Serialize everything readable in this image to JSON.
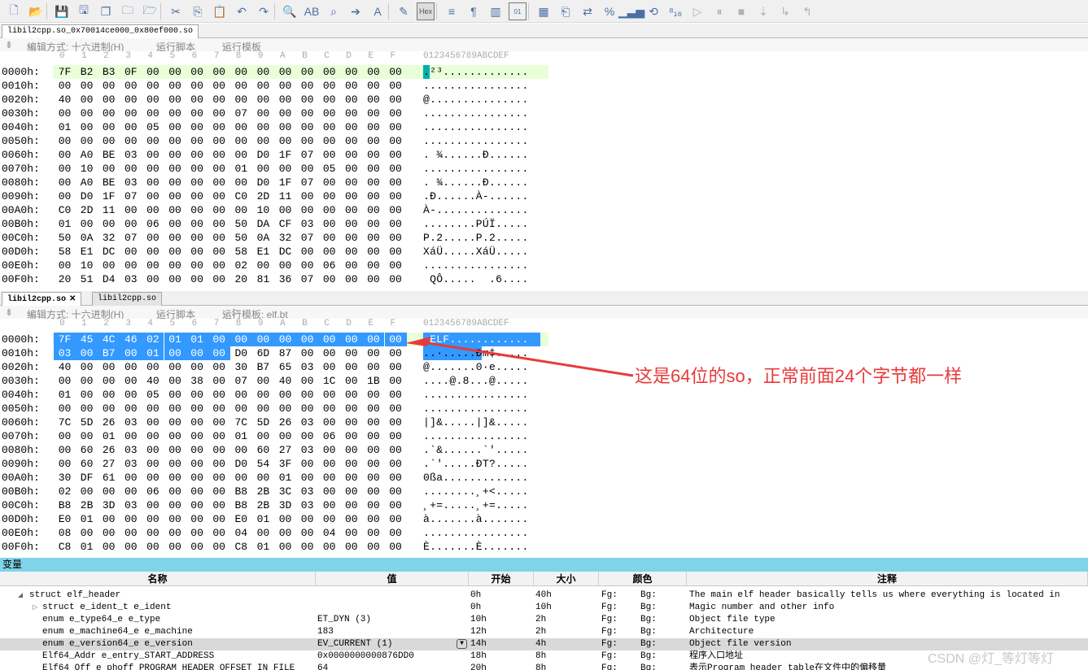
{
  "toolbar": {
    "icons": [
      "new-file-icon",
      "open-icon",
      "save-icon",
      "save-as-icon",
      "save-all-icon",
      "folder-icon",
      "workspace-icon",
      "cut-icon",
      "copy-icon",
      "paste-icon",
      "undo-icon",
      "redo-icon",
      "find-icon",
      "replace-icon",
      "find-in-files-icon",
      "goto-icon",
      "font-icon",
      "highlight-icon",
      "hex-mode-icon",
      "word-wrap-icon",
      "paragraph-icon",
      "columns-icon",
      "binary-icon",
      "calculator-icon",
      "template-icon",
      "compare-icon",
      "checksum-icon",
      "histogram-icon",
      "base-convert-icon",
      "base-icon",
      "run-icon",
      "pause-icon",
      "stop-icon",
      "step-icon",
      "step-in-icon",
      "step-out-icon"
    ],
    "hex_label": "Hex"
  },
  "top": {
    "tab_label": "libil2cpp.so_0x70014ce000_0x80ef000.so",
    "edit_mode": "编辑方式: 十六进制(H)",
    "run_script": "运行脚本",
    "run_template": "运行模板",
    "col_headers": [
      "0",
      "1",
      "2",
      "3",
      "4",
      "5",
      "6",
      "7",
      "8",
      "9",
      "A",
      "B",
      "C",
      "D",
      "E",
      "F"
    ],
    "ascii_header": "0123456789ABCDEF",
    "rows": [
      {
        "addr": "0000h:",
        "bytes": [
          "7F",
          "B2",
          "B3",
          "0F",
          "00",
          "00",
          "00",
          "00",
          "00",
          "00",
          "00",
          "00",
          "00",
          "00",
          "00",
          "00"
        ],
        "ascii": ".²³............."
      },
      {
        "addr": "0010h:",
        "bytes": [
          "00",
          "00",
          "00",
          "00",
          "00",
          "00",
          "00",
          "00",
          "00",
          "00",
          "00",
          "00",
          "00",
          "00",
          "00",
          "00"
        ],
        "ascii": "................"
      },
      {
        "addr": "0020h:",
        "bytes": [
          "40",
          "00",
          "00",
          "00",
          "00",
          "00",
          "00",
          "00",
          "00",
          "00",
          "00",
          "00",
          "00",
          "00",
          "00",
          "00"
        ],
        "ascii": "@..............."
      },
      {
        "addr": "0030h:",
        "bytes": [
          "00",
          "00",
          "00",
          "00",
          "00",
          "00",
          "00",
          "00",
          "07",
          "00",
          "00",
          "00",
          "00",
          "00",
          "00",
          "00"
        ],
        "ascii": "................"
      },
      {
        "addr": "0040h:",
        "bytes": [
          "01",
          "00",
          "00",
          "00",
          "05",
          "00",
          "00",
          "00",
          "00",
          "00",
          "00",
          "00",
          "00",
          "00",
          "00",
          "00"
        ],
        "ascii": "................"
      },
      {
        "addr": "0050h:",
        "bytes": [
          "00",
          "00",
          "00",
          "00",
          "00",
          "00",
          "00",
          "00",
          "00",
          "00",
          "00",
          "00",
          "00",
          "00",
          "00",
          "00"
        ],
        "ascii": "................"
      },
      {
        "addr": "0060h:",
        "bytes": [
          "00",
          "A0",
          "BE",
          "03",
          "00",
          "00",
          "00",
          "00",
          "00",
          "D0",
          "1F",
          "07",
          "00",
          "00",
          "00",
          "00"
        ],
        "ascii": ". ¾......Ð......"
      },
      {
        "addr": "0070h:",
        "bytes": [
          "00",
          "10",
          "00",
          "00",
          "00",
          "00",
          "00",
          "00",
          "01",
          "00",
          "00",
          "00",
          "05",
          "00",
          "00",
          "00"
        ],
        "ascii": "................"
      },
      {
        "addr": "0080h:",
        "bytes": [
          "00",
          "A0",
          "BE",
          "03",
          "00",
          "00",
          "00",
          "00",
          "00",
          "D0",
          "1F",
          "07",
          "00",
          "00",
          "00",
          "00"
        ],
        "ascii": ". ¾......Ð......"
      },
      {
        "addr": "0090h:",
        "bytes": [
          "00",
          "D0",
          "1F",
          "07",
          "00",
          "00",
          "00",
          "00",
          "C0",
          "2D",
          "11",
          "00",
          "00",
          "00",
          "00",
          "00"
        ],
        "ascii": ".Ð......À-......"
      },
      {
        "addr": "00A0h:",
        "bytes": [
          "C0",
          "2D",
          "11",
          "00",
          "00",
          "00",
          "00",
          "00",
          "00",
          "10",
          "00",
          "00",
          "00",
          "00",
          "00",
          "00"
        ],
        "ascii": "À-.............."
      },
      {
        "addr": "00B0h:",
        "bytes": [
          "01",
          "00",
          "00",
          "00",
          "06",
          "00",
          "00",
          "00",
          "50",
          "DA",
          "CF",
          "03",
          "00",
          "00",
          "00",
          "00"
        ],
        "ascii": "........PÚÏ....."
      },
      {
        "addr": "00C0h:",
        "bytes": [
          "50",
          "0A",
          "32",
          "07",
          "00",
          "00",
          "00",
          "00",
          "50",
          "0A",
          "32",
          "07",
          "00",
          "00",
          "00",
          "00"
        ],
        "ascii": "P.2.....P.2....."
      },
      {
        "addr": "00D0h:",
        "bytes": [
          "58",
          "E1",
          "DC",
          "00",
          "00",
          "00",
          "00",
          "00",
          "58",
          "E1",
          "DC",
          "00",
          "00",
          "00",
          "00",
          "00"
        ],
        "ascii": "XáÜ.....XáÜ....."
      },
      {
        "addr": "00E0h:",
        "bytes": [
          "00",
          "10",
          "00",
          "00",
          "00",
          "00",
          "00",
          "00",
          "02",
          "00",
          "00",
          "00",
          "06",
          "00",
          "00",
          "00"
        ],
        "ascii": "................"
      },
      {
        "addr": "00F0h:",
        "bytes": [
          "20",
          "51",
          "D4",
          "03",
          "00",
          "00",
          "00",
          "00",
          "20",
          "81",
          "36",
          "07",
          "00",
          "00",
          "00",
          "00"
        ],
        "ascii": " QÔ.....  .6...."
      }
    ]
  },
  "bottom": {
    "tab_active": "libil2cpp.so",
    "tab_other": "libil2cpp.so",
    "edit_mode": "编辑方式: 十六进制(H)",
    "run_script": "运行脚本",
    "run_template": "运行模板: elf.bt",
    "col_headers": [
      "0",
      "1",
      "2",
      "3",
      "4",
      "5",
      "6",
      "7",
      "8",
      "9",
      "A",
      "B",
      "C",
      "D",
      "E",
      "F"
    ],
    "ascii_header": "0123456789ABCDEF",
    "rows": [
      {
        "addr": "0000h:",
        "bytes": [
          "7F",
          "45",
          "4C",
          "46",
          "02",
          "01",
          "01",
          "00",
          "00",
          "00",
          "00",
          "00",
          "00",
          "00",
          "00",
          "00"
        ],
        "ascii": ".ELF............"
      },
      {
        "addr": "0010h:",
        "bytes": [
          "03",
          "00",
          "B7",
          "00",
          "01",
          "00",
          "00",
          "00",
          "D0",
          "6D",
          "87",
          "00",
          "00",
          "00",
          "00",
          "00"
        ],
        "ascii": "..·.....Ðm‡....."
      },
      {
        "addr": "0020h:",
        "bytes": [
          "40",
          "00",
          "00",
          "00",
          "00",
          "00",
          "00",
          "00",
          "30",
          "B7",
          "65",
          "03",
          "00",
          "00",
          "00",
          "00"
        ],
        "ascii": "@.......0·e....."
      },
      {
        "addr": "0030h:",
        "bytes": [
          "00",
          "00",
          "00",
          "00",
          "40",
          "00",
          "38",
          "00",
          "07",
          "00",
          "40",
          "00",
          "1C",
          "00",
          "1B",
          "00"
        ],
        "ascii": "....@.8...@....."
      },
      {
        "addr": "0040h:",
        "bytes": [
          "01",
          "00",
          "00",
          "00",
          "05",
          "00",
          "00",
          "00",
          "00",
          "00",
          "00",
          "00",
          "00",
          "00",
          "00",
          "00"
        ],
        "ascii": "................"
      },
      {
        "addr": "0050h:",
        "bytes": [
          "00",
          "00",
          "00",
          "00",
          "00",
          "00",
          "00",
          "00",
          "00",
          "00",
          "00",
          "00",
          "00",
          "00",
          "00",
          "00"
        ],
        "ascii": "................"
      },
      {
        "addr": "0060h:",
        "bytes": [
          "7C",
          "5D",
          "26",
          "03",
          "00",
          "00",
          "00",
          "00",
          "7C",
          "5D",
          "26",
          "03",
          "00",
          "00",
          "00",
          "00"
        ],
        "ascii": "|]&.....|]&....."
      },
      {
        "addr": "0070h:",
        "bytes": [
          "00",
          "00",
          "01",
          "00",
          "00",
          "00",
          "00",
          "00",
          "01",
          "00",
          "00",
          "00",
          "06",
          "00",
          "00",
          "00"
        ],
        "ascii": "................"
      },
      {
        "addr": "0080h:",
        "bytes": [
          "00",
          "60",
          "26",
          "03",
          "00",
          "00",
          "00",
          "00",
          "00",
          "60",
          "27",
          "03",
          "00",
          "00",
          "00",
          "00"
        ],
        "ascii": ".`&......`'....."
      },
      {
        "addr": "0090h:",
        "bytes": [
          "00",
          "60",
          "27",
          "03",
          "00",
          "00",
          "00",
          "00",
          "D0",
          "54",
          "3F",
          "00",
          "00",
          "00",
          "00",
          "00"
        ],
        "ascii": ".`'.....ÐT?....."
      },
      {
        "addr": "00A0h:",
        "bytes": [
          "30",
          "DF",
          "61",
          "00",
          "00",
          "00",
          "00",
          "00",
          "00",
          "00",
          "01",
          "00",
          "00",
          "00",
          "00",
          "00"
        ],
        "ascii": "0ßa............."
      },
      {
        "addr": "00B0h:",
        "bytes": [
          "02",
          "00",
          "00",
          "00",
          "06",
          "00",
          "00",
          "00",
          "B8",
          "2B",
          "3C",
          "03",
          "00",
          "00",
          "00",
          "00"
        ],
        "ascii": "........¸+<....."
      },
      {
        "addr": "00C0h:",
        "bytes": [
          "B8",
          "2B",
          "3D",
          "03",
          "00",
          "00",
          "00",
          "00",
          "B8",
          "2B",
          "3D",
          "03",
          "00",
          "00",
          "00",
          "00"
        ],
        "ascii": "¸+=.....¸+=....."
      },
      {
        "addr": "00D0h:",
        "bytes": [
          "E0",
          "01",
          "00",
          "00",
          "00",
          "00",
          "00",
          "00",
          "E0",
          "01",
          "00",
          "00",
          "00",
          "00",
          "00",
          "00"
        ],
        "ascii": "à.......à......."
      },
      {
        "addr": "00E0h:",
        "bytes": [
          "08",
          "00",
          "00",
          "00",
          "00",
          "00",
          "00",
          "00",
          "04",
          "00",
          "00",
          "00",
          "04",
          "00",
          "00",
          "00"
        ],
        "ascii": "................"
      },
      {
        "addr": "00F0h:",
        "bytes": [
          "C8",
          "01",
          "00",
          "00",
          "00",
          "00",
          "00",
          "00",
          "C8",
          "01",
          "00",
          "00",
          "00",
          "00",
          "00",
          "00"
        ],
        "ascii": "È.......È......."
      }
    ]
  },
  "annotation": "这是64位的so，正常前面24个字节都一样",
  "variables": {
    "title": "变量",
    "headers": {
      "name": "名称",
      "value": "值",
      "start": "开始",
      "size": "大小",
      "color": "颜色",
      "comment": "注释"
    },
    "rows": [
      {
        "name": "struct elf_header",
        "value": "",
        "start": "0h",
        "size": "40h",
        "fg": "Fg:",
        "bg": "Bg:",
        "comment": "The main elf header basically tells us where everything is located in",
        "expander": "◢"
      },
      {
        "name": "struct e_ident_t e_ident",
        "value": "",
        "start": "0h",
        "size": "10h",
        "fg": "Fg:",
        "bg": "Bg:",
        "comment": "Magic number and other info",
        "expander": "▷"
      },
      {
        "name": "enum e_type64_e e_type",
        "value": "ET_DYN (3)",
        "start": "10h",
        "size": "2h",
        "fg": "Fg:",
        "bg": "Bg:",
        "comment": "Object file type",
        "expander": ""
      },
      {
        "name": "enum e_machine64_e e_machine",
        "value": "183",
        "start": "12h",
        "size": "2h",
        "fg": "Fg:",
        "bg": "Bg:",
        "comment": "Architecture",
        "expander": ""
      },
      {
        "name": "enum e_version64_e e_version",
        "value": "EV_CURRENT (1)",
        "start": "14h",
        "size": "4h",
        "fg": "Fg:",
        "bg": "Bg:",
        "comment": "Object file version",
        "expander": ""
      },
      {
        "name": "Elf64_Addr e_entry_START_ADDRESS",
        "value": "0x0000000000876DD0",
        "start": "18h",
        "size": "8h",
        "fg": "Fg:",
        "bg": "Bg:",
        "comment": "程序入口地址",
        "expander": ""
      },
      {
        "name": "Elf64_Off e_phoff_PROGRAM_HEADER_OFFSET_IN_FILE",
        "value": "64",
        "start": "20h",
        "size": "8h",
        "fg": "Fg:",
        "bg": "Bg:",
        "comment": "表示Program header table在文件中的偏移量",
        "expander": ""
      }
    ]
  },
  "watermark": "CSDN @灯_等灯等灯"
}
